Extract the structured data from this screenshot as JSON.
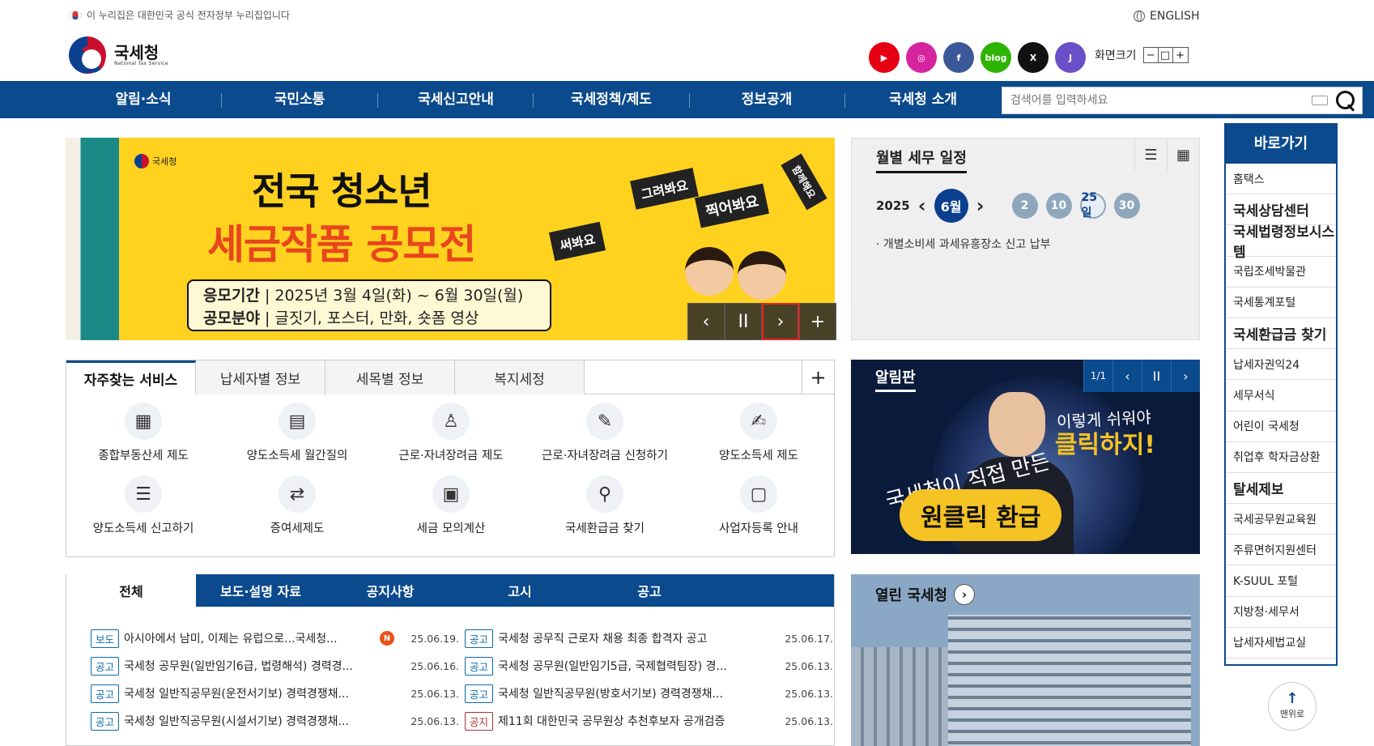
{
  "gov_notice": "이 누리집은 대한민국 공식 전자정부 누리집입니다",
  "english_label": "ENGLISH",
  "logo": {
    "title": "국세청",
    "subtitle": "National Tax Service"
  },
  "social": [
    {
      "name": "youtube",
      "color": "#e60012",
      "glyph": "▶"
    },
    {
      "name": "instagram",
      "color": "#d6249f",
      "glyph": "◎"
    },
    {
      "name": "facebook",
      "color": "#3b5998",
      "glyph": "f"
    },
    {
      "name": "blog",
      "color": "#2db400",
      "glyph": "blog"
    },
    {
      "name": "x",
      "color": "#111111",
      "glyph": "X"
    },
    {
      "name": "kakao",
      "color": "#6a4fc9",
      "glyph": "J"
    }
  ],
  "screen_size": {
    "label": "화면크기",
    "minus": "−",
    "reset": "□",
    "plus": "+"
  },
  "nav": [
    "알림·소식",
    "국민소통",
    "국세신고안내",
    "국세정책/제도",
    "정보공개",
    "국세청 소개"
  ],
  "search": {
    "placeholder": "검색어를 입력하세요"
  },
  "banner": {
    "agency": "국세청",
    "line1": "전국 청소년",
    "line2": "세금작품 공모전",
    "period_label": "응모기간",
    "period": "2025년 3월 4일(화) ~ 6월 30일(월)",
    "field_label": "공모분야",
    "field": "글짓기, 포스터, 만화, 숏폼 영상",
    "bubbles": [
      "그려봐요",
      "찍어봐요",
      "써봐요",
      "함께해요"
    ],
    "controls": {
      "prev": "‹",
      "pause": "II",
      "next": "›",
      "more": "+"
    }
  },
  "calendar": {
    "title": "월별 세무 일정",
    "year": "2025",
    "month": "6월",
    "days": [
      "2",
      "10",
      "25일",
      "30"
    ],
    "selected_day": "25일",
    "note": "· 개별소비세 과세유흥장소 신고 납부"
  },
  "quick_links": {
    "title": "바로가기",
    "items": [
      {
        "label": "홈택스",
        "big": false
      },
      {
        "label": "국세상담센터",
        "big": true
      },
      {
        "label": "국세법령정보시스템",
        "big": true
      },
      {
        "label": "국립조세박물관",
        "big": false
      },
      {
        "label": "국세통계포털",
        "big": false
      },
      {
        "label": "국세환급금 찾기",
        "big": true
      },
      {
        "label": "납세자권익24",
        "big": false
      },
      {
        "label": "세무서식",
        "big": false
      },
      {
        "label": "어린이 국세청",
        "big": false
      },
      {
        "label": "취업후 학자금상환",
        "big": false
      },
      {
        "label": "탈세제보",
        "big": true
      },
      {
        "label": "국세공무원교육원",
        "big": false
      },
      {
        "label": "주류면허지원센터",
        "big": false
      },
      {
        "label": "K-SUUL 포털",
        "big": false
      },
      {
        "label": "지방청·세무서",
        "big": false
      },
      {
        "label": "납세자세법교실",
        "big": false
      }
    ],
    "top_button": "맨위로"
  },
  "services": {
    "tabs": [
      "자주찾는 서비스",
      "납세자별 정보",
      "세목별 정보",
      "복지세정"
    ],
    "plus": "+",
    "items": [
      {
        "label": "종합부동산세 제도",
        "icon": "building-icon",
        "glyph": "▦"
      },
      {
        "label": "양도소득세 월간질의",
        "icon": "document-stack-icon",
        "glyph": "▤"
      },
      {
        "label": "근로·자녀장려금 제도",
        "icon": "person-icon",
        "glyph": "♙"
      },
      {
        "label": "근로·자녀장려금 신청하기",
        "icon": "form-edit-icon",
        "glyph": "✎"
      },
      {
        "label": "양도소득세 제도",
        "icon": "pen-card-icon",
        "glyph": "✍"
      },
      {
        "label": "양도소득세 신고하기",
        "icon": "list-document-icon",
        "glyph": "☰"
      },
      {
        "label": "증여세제도",
        "icon": "exchange-people-icon",
        "glyph": "⇄"
      },
      {
        "label": "세금 모의계산",
        "icon": "calculator-icon",
        "glyph": "▣"
      },
      {
        "label": "국세환급금 찾기",
        "icon": "magnifier-icon",
        "glyph": "⚲"
      },
      {
        "label": "사업자등록 안내",
        "icon": "id-card-icon",
        "glyph": "▢"
      }
    ]
  },
  "notice_board": {
    "title": "알림판",
    "counter": "1/1",
    "text1": "이렇게 쉬워야",
    "text2": "클릭하지!",
    "text3": "국세청이 직접 만든",
    "button": "원클릭 환급"
  },
  "news": {
    "tabs": [
      "전체",
      "보도·설명 자료",
      "공지사항",
      "고시",
      "공고"
    ],
    "left": [
      {
        "badge": "보도",
        "text": "아시아에서 남미, 이제는 유럽으로...국세청...",
        "date": "25.06.19.",
        "new": "N"
      },
      {
        "badge": "공고",
        "text": "국세청 공무원(일반임기6급, 법령해석) 경력경...",
        "date": "25.06.16."
      },
      {
        "badge": "공고",
        "text": "국세청 일반직공무원(운전서기보) 경력경쟁채...",
        "date": "25.06.13."
      },
      {
        "badge": "공고",
        "text": "국세청 일반직공무원(시설서기보) 경력경쟁채...",
        "date": "25.06.13."
      }
    ],
    "right": [
      {
        "badge": "공고",
        "text": "국세청 공무직 근로자 채용 최종 합격자 공고",
        "date": "25.06.17."
      },
      {
        "badge": "공고",
        "text": "국세청 공무원(일반임기5급, 국제협력팀장) 경...",
        "date": "25.06.13."
      },
      {
        "badge": "공고",
        "text": "국세청 일반직공무원(방호서기보) 경력경쟁채...",
        "date": "25.06.13."
      },
      {
        "badge": "공지",
        "text": "제11회 대한민국 공무원상 추천후보자 공개검증",
        "date": "25.06.13.",
        "red": true
      }
    ]
  },
  "open_nts": {
    "title": "열린 국세청",
    "arrow": "›"
  }
}
